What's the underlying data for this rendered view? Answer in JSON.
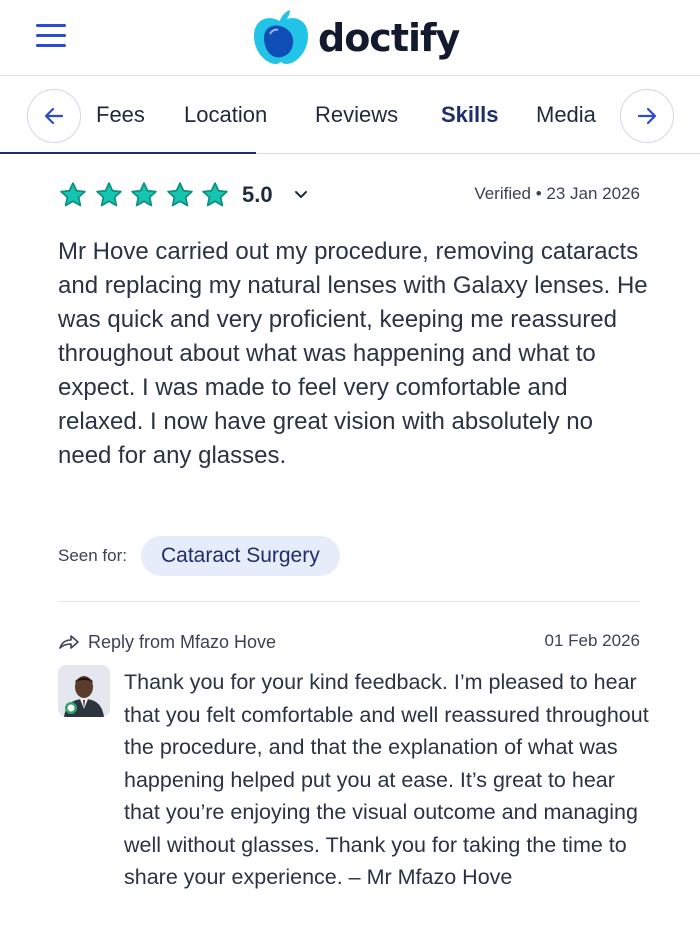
{
  "header": {
    "brand": "doctify",
    "menu_icon": "hamburger-menu-icon",
    "colors": {
      "brand_blue": "#2b4bd1",
      "brand_dark": "#141a2e",
      "logo_cyan": "#21c4e6"
    }
  },
  "tabs": {
    "items": [
      {
        "label": "Fees",
        "active": false
      },
      {
        "label": "Location",
        "active": false
      },
      {
        "label": "Reviews",
        "active": false
      },
      {
        "label": "Skills",
        "active": true
      },
      {
        "label": "Media",
        "active": false
      }
    ],
    "prev_icon": "arrow-left-icon",
    "next_icon": "arrow-right-icon"
  },
  "review": {
    "rating": "5.0",
    "stars": 5,
    "star_color": "#17c4b0",
    "verified": "Verified • 23 Jan 2026",
    "text": "Mr Hove carried out my procedure, removing cataracts and replacing my natural lenses with Galaxy lenses. He was quick and very proficient, keeping me reassured throughout about what was happening and what to expect. I was made to feel very comfortable and relaxed. I now have great vision with absolutely no need for any glasses.",
    "seen_for_label": "Seen for:",
    "seen_for_tag": "Cataract Surgery"
  },
  "reply": {
    "label": "Reply from Mfazo Hove",
    "date": "01 Feb 2026",
    "text": "Thank you for your kind feedback. I’m pleased to hear that you felt comfortable and well reassured throughout the procedure, and that the explanation of what was happening helped put you at ease. It’s great to hear that you’re enjoying the visual outcome and managing well without glasses. Thank you for taking the time to share your experience. – Mr Mfazo Hove"
  }
}
